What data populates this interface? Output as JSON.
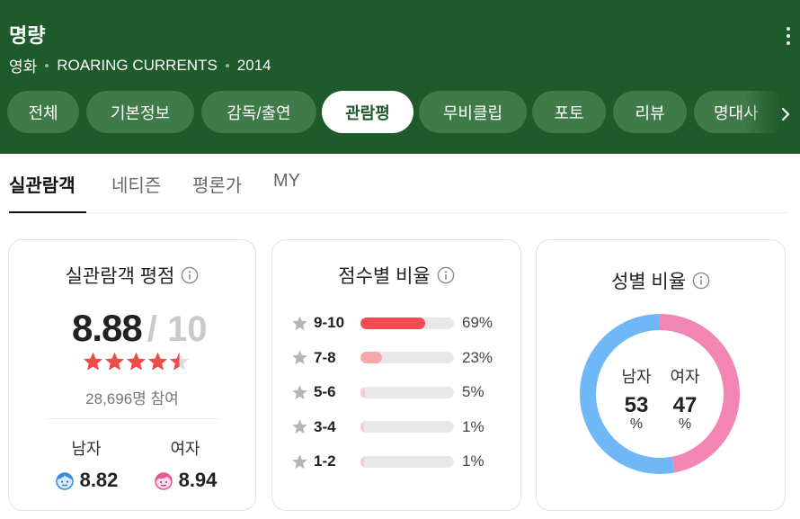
{
  "header": {
    "title": "명량",
    "category": "영화",
    "english_title": "ROARING CURRENTS",
    "year": "2014"
  },
  "tabs": [
    {
      "label": "전체",
      "active": false
    },
    {
      "label": "기본정보",
      "active": false
    },
    {
      "label": "감독/출연",
      "active": false
    },
    {
      "label": "관람평",
      "active": true
    },
    {
      "label": "무비클립",
      "active": false
    },
    {
      "label": "포토",
      "active": false
    },
    {
      "label": "리뷰",
      "active": false
    },
    {
      "label": "명대사",
      "active": false
    }
  ],
  "subtabs": [
    {
      "label": "실관람객",
      "active": true
    },
    {
      "label": "네티즌",
      "active": false
    },
    {
      "label": "평론가",
      "active": false
    },
    {
      "label": "MY",
      "active": false
    }
  ],
  "rating_card": {
    "title": "실관람객 평점",
    "score": "8.88",
    "max": "/ 10",
    "stars": 4.5,
    "participants": "28,696명 참여",
    "male_label": "남자",
    "male_score": "8.82",
    "female_label": "여자",
    "female_score": "8.94"
  },
  "distribution_card": {
    "title": "점수별 비율",
    "rows": [
      {
        "label": "9-10",
        "percent": 69,
        "display": "69%"
      },
      {
        "label": "7-8",
        "percent": 23,
        "display": "23%"
      },
      {
        "label": "5-6",
        "percent": 5,
        "display": "5%"
      },
      {
        "label": "3-4",
        "percent": 1,
        "display": "1%"
      },
      {
        "label": "1-2",
        "percent": 1,
        "display": "1%"
      }
    ]
  },
  "gender_card": {
    "title": "성별 비율",
    "male_label": "남자",
    "male_value": "53",
    "female_label": "여자",
    "female_value": "47",
    "unit": "%",
    "male_percent": 53,
    "female_percent": 47
  },
  "colors": {
    "header_bg": "#1f5a2a",
    "tab_bg": "#3f7a49",
    "star_red": "#ef4b4b",
    "bar_top": "#f04c52",
    "bar_second": "#f6a7aa",
    "bar_low": "#f9c9cb",
    "male_blue": "#6fb7f7",
    "female_pink": "#f285b1"
  }
}
